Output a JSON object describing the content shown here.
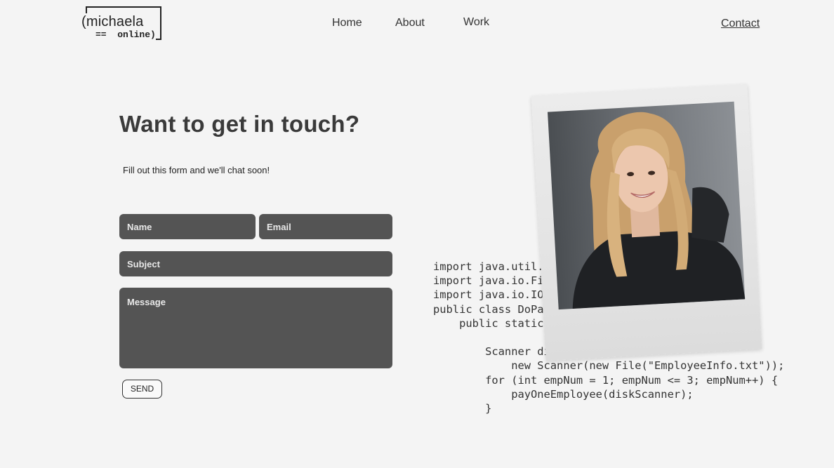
{
  "logo": {
    "name": "(michaela",
    "sub": "==  online)"
  },
  "nav": {
    "home": "Home",
    "about": "About",
    "work": "Work",
    "contact": "Contact"
  },
  "hero": {
    "heading": "Want to get in touch?",
    "subtext": "Fill out this form and we'll chat soon!"
  },
  "form": {
    "name_placeholder": "Name",
    "email_placeholder": "Email",
    "subject_placeholder": "Subject",
    "message_placeholder": "Message",
    "send_label": "SEND"
  },
  "code_snippet": {
    "text": "import java.util.S\nimport java.io.Fil\nimport java.io.IOE\npublic class DoPay\n    public static                          n {\n\n        Scanner dis\n            new Scanner(new File(\"EmployeeInfo.txt\"));\n        for (int empNum = 1; empNum <= 3; empNum++) {\n            payOneEmployee(diskScanner);\n        }"
  },
  "photo": {
    "alt": "portrait-photo"
  }
}
